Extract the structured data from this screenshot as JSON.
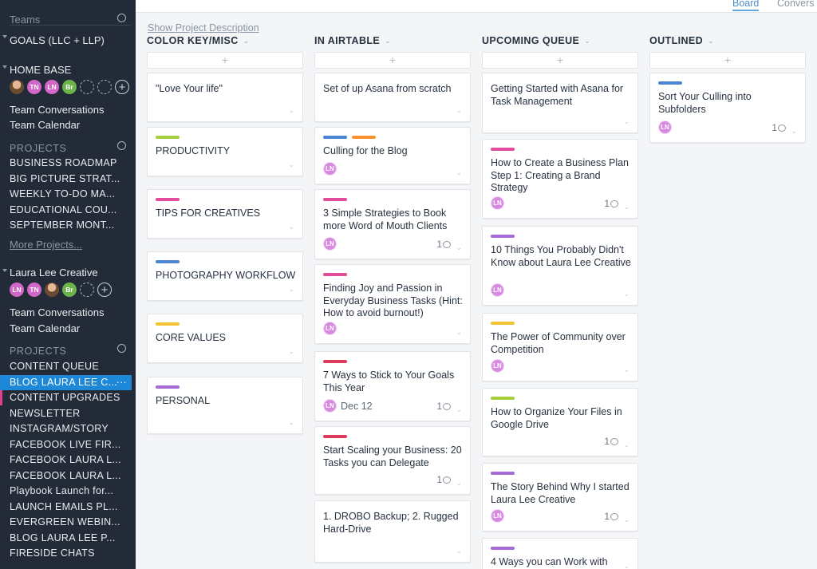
{
  "sidebar": {
    "teams_label": "Teams",
    "goals_team": "GOALS (LLC + LLP)",
    "home_base": {
      "name": "HOME BASE",
      "avatars": [
        "",
        "TN",
        "LN",
        "Br"
      ],
      "links": [
        "Team Conversations",
        "Team Calendar"
      ],
      "projects_label": "PROJECTS",
      "projects": [
        "BUSINESS ROADMAP",
        "BIG PICTURE STRAT...",
        "WEEKLY TO-DO MA...",
        "EDUCATIONAL COU...",
        "SEPTEMBER MONT..."
      ],
      "more": "More Projects..."
    },
    "laura": {
      "name": "Laura Lee Creative",
      "avatars": [
        "LN",
        "TN",
        "",
        "Br"
      ],
      "links": [
        "Team Conversations",
        "Team Calendar"
      ],
      "projects_label": "PROJECTS",
      "projects": [
        "CONTENT QUEUE",
        "BLOG LAURA LEE C...",
        "CONTENT UPGRADES",
        "NEWSLETTER",
        "INSTAGRAM/STORY",
        "FACEBOOK LIVE FIR...",
        "FACEBOOK LAURA L...",
        "FACEBOOK LAURA L...",
        "Playbook Launch for...",
        "LAUNCH EMAILS PL...",
        "EVERGREEN WEBIN...",
        "BLOG LAURA LEE P...",
        "FIRESIDE CHATS"
      ],
      "active_more": "···"
    }
  },
  "topbar": {
    "tabs": [
      "Board",
      "Convers"
    ]
  },
  "show_description": "Show Project Description",
  "add_symbol": "+",
  "colors": {
    "green": "#a5cf3c",
    "pink": "#e24c9a",
    "blue": "#4a86d4",
    "yellow": "#f5c231",
    "purple": "#a56bd6",
    "orange": "#f6932d",
    "red": "#e03a5a",
    "active": "#1e88d8"
  },
  "columns": [
    {
      "title": "COLOR KEY/MISC",
      "cards": [
        {
          "title": "\"Love Your life\""
        },
        {
          "title": "PRODUCTIVITY",
          "tags": [
            "green"
          ]
        },
        {
          "title": "TIPS FOR CREATIVES",
          "tags": [
            "pink"
          ]
        },
        {
          "title": "PHOTOGRAPHY WORKFLOW",
          "tags": [
            "blue"
          ]
        },
        {
          "title": "CORE VALUES",
          "tags": [
            "yellow"
          ]
        },
        {
          "title": "PERSONAL",
          "tags": [
            "purple"
          ]
        }
      ]
    },
    {
      "title": "IN AIRTABLE",
      "cards": [
        {
          "title": "Set of up Asana from scratch"
        },
        {
          "title": "Culling for the Blog",
          "tags": [
            "blue",
            "orange"
          ],
          "assignee": "LN"
        },
        {
          "title": "3 Simple Strategies to Book more Word of Mouth Clients",
          "tags": [
            "pink"
          ],
          "assignee": "LN",
          "comments": "1"
        },
        {
          "title": "Finding Joy and Passion in Everyday Business Tasks (Hint: How to avoid burnout!)",
          "tags": [
            "pink"
          ],
          "assignee": "LN"
        },
        {
          "title": "7 Ways to Stick to Your Goals This Year",
          "tags": [
            "red"
          ],
          "assignee": "LN",
          "due": "Dec 12",
          "comments": "1"
        },
        {
          "title": "Start Scaling your Business: 20 Tasks you can Delegate",
          "tags": [
            "red"
          ],
          "comments": "1"
        },
        {
          "title": "1. DROBO Backup; 2. Rugged Hard-Drive"
        }
      ]
    },
    {
      "title": "UPCOMING QUEUE",
      "cards": [
        {
          "title": "Getting Started with Asana for Task Management"
        },
        {
          "title": "How to Create a Business Plan Step 1: Creating a Brand Strategy",
          "tags": [
            "pink"
          ],
          "assignee": "LN",
          "comments": "1"
        },
        {
          "title": "10 Things You Probably Didn't Know about Laura Lee Creative",
          "tags": [
            "purple"
          ],
          "assignee": "LN"
        },
        {
          "title": "The Power of Community over Competition",
          "tags": [
            "yellow"
          ],
          "assignee": "LN"
        },
        {
          "title": "How to Organize Your Files in Google Drive",
          "tags": [
            "green"
          ],
          "comments": "1"
        },
        {
          "title": "The Story Behind Why I started Laura Lee Creative",
          "tags": [
            "purple"
          ],
          "assignee": "LN",
          "comments": "1"
        },
        {
          "title": "4 Ways you can Work with",
          "tags": [
            "purple"
          ]
        }
      ]
    },
    {
      "title": "OUTLINED",
      "cards": [
        {
          "title": "Sort Your Culling into Subfolders",
          "tags": [
            "blue"
          ],
          "assignee": "LN",
          "comments": "1"
        }
      ]
    }
  ]
}
